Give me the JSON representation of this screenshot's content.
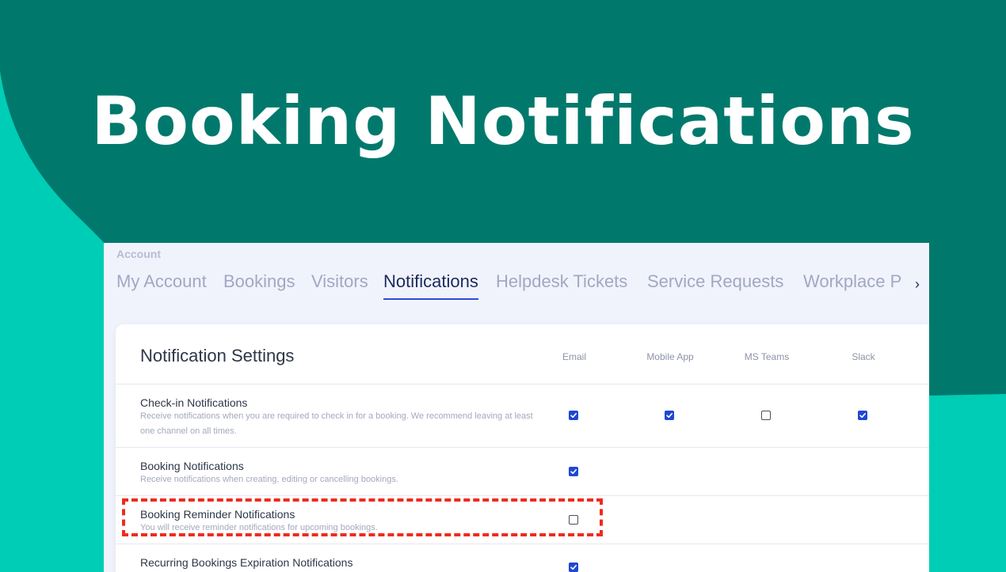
{
  "hero": {
    "title": "Booking Notifications"
  },
  "account": {
    "section_label": "Account",
    "tabs": [
      {
        "label": "My Account",
        "active": false
      },
      {
        "label": "Bookings",
        "active": false
      },
      {
        "label": "Visitors",
        "active": false
      },
      {
        "label": "Notifications",
        "active": true
      },
      {
        "label": "Helpdesk Tickets",
        "active": false
      },
      {
        "label": "Service Requests",
        "active": false
      },
      {
        "label": "Workplace P",
        "active": false
      }
    ],
    "more_icon": "chevron-right-icon"
  },
  "settings": {
    "title": "Notification Settings",
    "columns": [
      "Email",
      "Mobile App",
      "MS Teams",
      "Slack"
    ],
    "rows": [
      {
        "title": "Check-in Notifications",
        "description": "Receive notifications when you are required to check in for a booking. We recommend leaving at least one channel on all times.",
        "channels": [
          true,
          true,
          false,
          true
        ]
      },
      {
        "title": "Booking Notifications",
        "description": "Receive notifications when creating, editing or cancelling bookings.",
        "channels": [
          true
        ]
      },
      {
        "title": "Booking Reminder Notifications",
        "description": "You will receive reminder notifications for upcoming bookings.",
        "channels": [
          false
        ],
        "highlighted": true
      },
      {
        "title": "Recurring Bookings Expiration Notifications",
        "description": "",
        "channels": [
          true
        ]
      }
    ]
  },
  "colors": {
    "background_light": "#00cdb5",
    "background_dark": "#00796c",
    "checkbox_checked": "#1f48d4",
    "highlight_border": "#ee2b1f",
    "active_tab": "#1c2a5c"
  }
}
